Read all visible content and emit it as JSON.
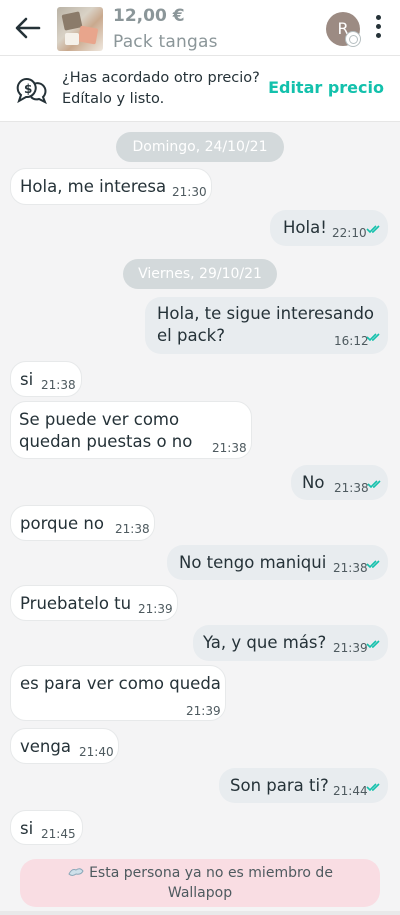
{
  "header": {
    "price": "12,00 €",
    "title": "Pack tangas",
    "avatar_initial": "R"
  },
  "offer": {
    "line1": "¿Has acordado otro precio?",
    "line2": "Edítalo y listo.",
    "edit_label": "Editar precio"
  },
  "dates": [
    "Domingo, 24/10/21",
    "Viernes, 29/10/21"
  ],
  "messages": [
    {
      "dir": "in",
      "lines": [
        "Hola, me interesa"
      ],
      "time": "21:30"
    },
    {
      "dir": "out",
      "lines": [
        "Hola!"
      ],
      "time": "22:10"
    },
    {
      "dir": "out",
      "lines": [
        "Hola, te sigue interesando",
        "el pack?"
      ],
      "time": "16:12"
    },
    {
      "dir": "in",
      "lines": [
        "si"
      ],
      "time": "21:38"
    },
    {
      "dir": "in",
      "lines": [
        "Se puede ver como",
        "quedan puestas o no"
      ],
      "time": "21:38"
    },
    {
      "dir": "out",
      "lines": [
        "No"
      ],
      "time": "21:38"
    },
    {
      "dir": "in",
      "lines": [
        "porque no"
      ],
      "time": "21:38"
    },
    {
      "dir": "out",
      "lines": [
        "No tengo maniqui"
      ],
      "time": "21:38"
    },
    {
      "dir": "in",
      "lines": [
        "Pruebatelo tu"
      ],
      "time": "21:39"
    },
    {
      "dir": "out",
      "lines": [
        "Ya, y que más?"
      ],
      "time": "21:39"
    },
    {
      "dir": "in",
      "lines": [
        "es para ver como queda"
      ],
      "time": "21:39"
    },
    {
      "dir": "in",
      "lines": [
        "venga"
      ],
      "time": "21:40"
    },
    {
      "dir": "out",
      "lines": [
        "Son para ti?"
      ],
      "time": "21:44"
    },
    {
      "dir": "in",
      "lines": [
        "si"
      ],
      "time": "21:45"
    }
  ],
  "banner": {
    "line1": "Esta persona ya no es miembro de",
    "line2": "Wallapop"
  },
  "colors": {
    "accent": "#13c1ac",
    "check": "#13c1ac",
    "banner_bg": "#f9dde3",
    "date_pill": "#d3d9db"
  },
  "icons": [
    "back-arrow-icon",
    "more-vertical-icon",
    "price-chat-icon",
    "double-check-icon",
    "gone-user-icon"
  ]
}
